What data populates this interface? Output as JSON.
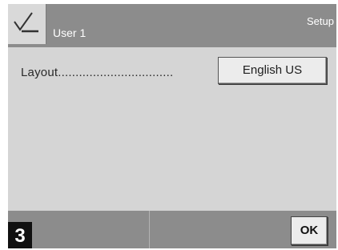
{
  "header": {
    "user_label": "User 1",
    "screen_title": "Setup",
    "user_icon": "checkmark-pen-icon"
  },
  "main": {
    "setting_label": "Layout.................................",
    "setting_value": "English US"
  },
  "footer": {
    "step_number": "3",
    "ok_label": "OK"
  },
  "colors": {
    "header_bg": "#8c8c8c",
    "body_bg": "#d5d5d5",
    "button_bg": "#ececec",
    "badge_bg": "#111111"
  }
}
